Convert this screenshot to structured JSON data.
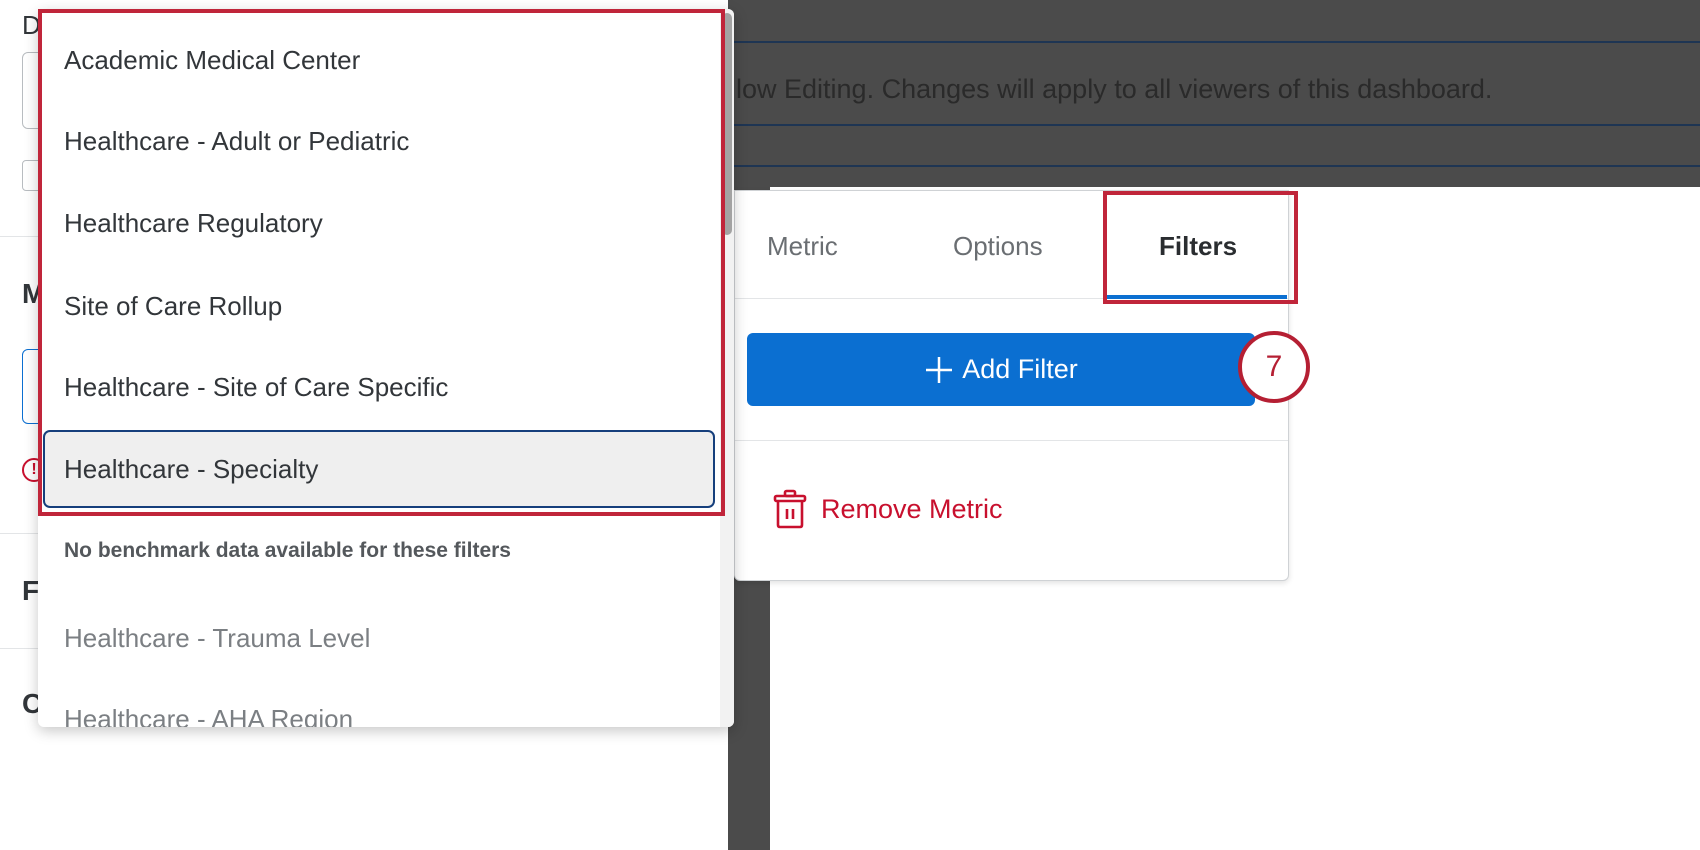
{
  "left_panel": {
    "label_d": "D",
    "label_m": "M",
    "label_f": "F",
    "label_c": "C"
  },
  "banner": {
    "text": "low Editing. Changes will apply to all viewers of this dashboard."
  },
  "metric_panel": {
    "tabs": [
      {
        "label": "Metric"
      },
      {
        "label": "Options"
      },
      {
        "label": "Filters",
        "active": true
      }
    ],
    "add_filter_label": "Add Filter",
    "remove_metric_label": "Remove Metric"
  },
  "step_marker": "7",
  "dropdown": {
    "items": [
      {
        "label": "Academic Medical Center"
      },
      {
        "label": "Healthcare - Adult or Pediatric"
      },
      {
        "label": "Healthcare Regulatory"
      },
      {
        "label": "Site of Care Rollup"
      },
      {
        "label": "Healthcare - Site of Care Specific"
      },
      {
        "label": "Healthcare - Specialty",
        "selected": true
      }
    ],
    "section_label": "No benchmark data available for these filters",
    "disabled_items": [
      {
        "label": "Healthcare - Trauma Level"
      },
      {
        "label": "Healthcare - AHA Region"
      }
    ]
  },
  "colors": {
    "accent": "#0b6fd1",
    "danger": "#c8102e",
    "highlight": "#c0253a",
    "overlay": "#4b4b4b"
  }
}
